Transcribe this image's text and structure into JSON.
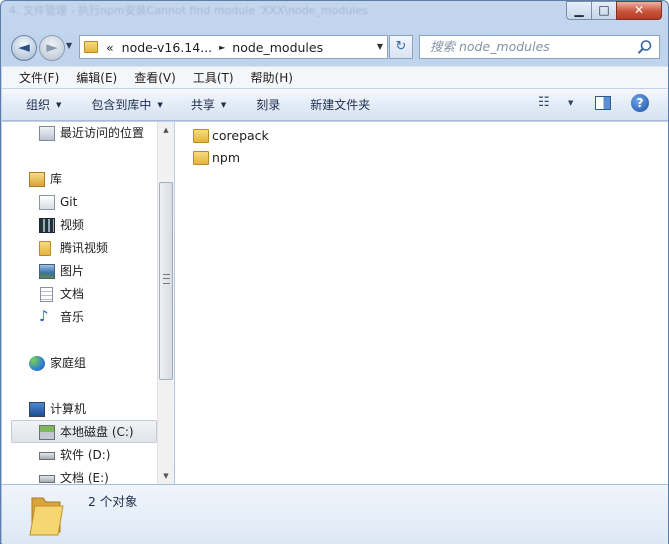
{
  "window": {
    "title": "4. 文件管理 - 执行npm安装Cannot find module 'XXX\\node_modules",
    "min_glyph": "▁",
    "max_glyph": "□",
    "close_glyph": "✕"
  },
  "nav": {
    "back_glyph": "◄",
    "forward_glyph": "►",
    "recent_glyph": "▼"
  },
  "address": {
    "overflow": "«",
    "segments": [
      "node-v16.14...",
      "node_modules"
    ],
    "separator": "►",
    "dropdown": "▼"
  },
  "refresh_glyph": "↻",
  "search": {
    "placeholder": "搜索 node_modules"
  },
  "menu": [
    "文件(F)",
    "编辑(E)",
    "查看(V)",
    "工具(T)",
    "帮助(H)"
  ],
  "commands": {
    "organize": "组织",
    "include_library": "包含到库中",
    "share": "共享",
    "burn": "刻录",
    "new_folder": "新建文件夹",
    "dropdown_glyph": "▼",
    "view_glyph": "☷",
    "help_glyph": "?"
  },
  "sidebar": [
    {
      "label": "最近访问的位置",
      "icon": "recent-places-icon"
    },
    {
      "label": "库",
      "icon": "library-icon"
    },
    {
      "label": "Git",
      "icon": "git-library-icon"
    },
    {
      "label": "视频",
      "icon": "video-icon"
    },
    {
      "label": "腾讯视频",
      "icon": "folder-icon"
    },
    {
      "label": "图片",
      "icon": "picture-icon"
    },
    {
      "label": "文档",
      "icon": "document-icon"
    },
    {
      "label": "音乐",
      "icon": "music-icon"
    },
    {
      "label": "家庭组",
      "icon": "homegroup-icon"
    },
    {
      "label": "计算机",
      "icon": "computer-icon"
    },
    {
      "label": "本地磁盘 (C:)",
      "icon": "system-drive-icon",
      "selected": true
    },
    {
      "label": "软件 (D:)",
      "icon": "drive-icon"
    },
    {
      "label": "文档 (E:)",
      "icon": "drive-icon"
    }
  ],
  "scrollbar": {
    "up_glyph": "▲",
    "down_glyph": "▼"
  },
  "files": [
    {
      "name": "corepack",
      "icon": "folder-icon"
    },
    {
      "name": "npm",
      "icon": "folder-icon"
    }
  ],
  "details": {
    "item_count": "2 个对象"
  }
}
